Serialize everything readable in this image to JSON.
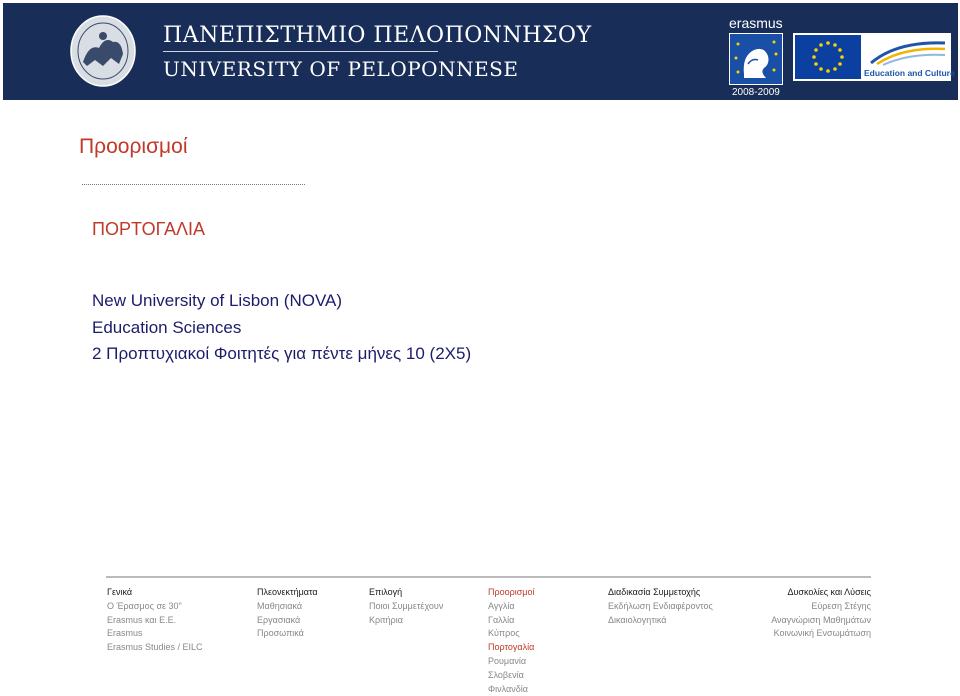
{
  "header": {
    "title": "ΠΑΝΕΠΙΣΤΗΜΙΟ ΠΕΛΟΠΟΝΝΗΣΟΥ",
    "subtitle": "UNIVERSITY OF PELOPONNESE",
    "erasmus_label": "erasmus",
    "erasmus_years": "2008-2009",
    "eu_caption": "Education and Culture",
    "background_color": "#182d57"
  },
  "main": {
    "page_title": "Προορισμοί",
    "country": "ΠΟΡΤΟΓΑΛΙΑ",
    "lines": [
      "New University of Lisbon (NOVA)",
      "Education Sciences",
      "2 Προπτυχιακοί Φοιτητές για πέντε μήνες  10 (2Χ5)"
    ],
    "accent_color": "#c0392b",
    "text_color": "#1c1c6b"
  },
  "footer": {
    "columns": [
      {
        "heading": "Γενικά",
        "items": [
          "Ο Έρασμος σε 30\"",
          "Erasmus και Ε.Ε.",
          "Erasmus",
          "Erasmus Studies / EILC"
        ]
      },
      {
        "heading": "Πλεονεκτήματα",
        "items": [
          "Μαθησιακά",
          "Εργασιακά",
          "Προσωπικά"
        ]
      },
      {
        "heading": "Επιλογή",
        "items": [
          "Ποιοι Συμμετέχουν",
          "Κριτήρια"
        ]
      },
      {
        "heading": "Προορισμοί",
        "items": [
          "Αγγλία",
          "Γαλλία",
          "Κύπρος",
          "Πορτογαλία",
          "Ρουμανία",
          "Σλοβενία",
          "Φινλανδία"
        ]
      },
      {
        "heading": "Διαδικασία Συμμετοχής",
        "items": [
          "Εκδήλωση Ενδιαφέροντος",
          "Δικαιολογητικά"
        ]
      },
      {
        "heading": "Δυσκολίες και Λύσεις",
        "items": [
          "Εύρεση Στέγης",
          "Αναγνώριση Μαθημάτων",
          "Κοινωνική Ενσωμάτωση"
        ]
      }
    ]
  }
}
